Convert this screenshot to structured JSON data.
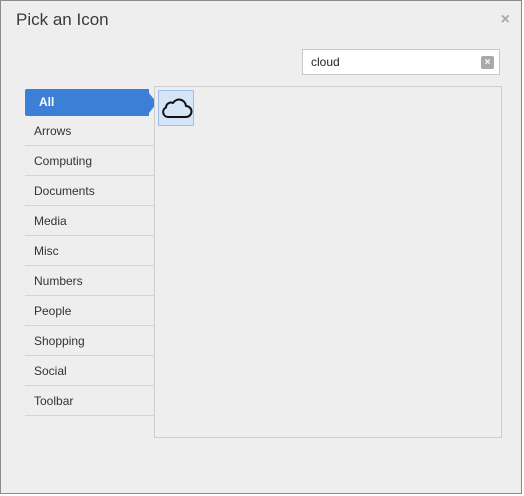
{
  "dialog": {
    "title": "Pick an Icon",
    "close_glyph": "×"
  },
  "search": {
    "value": "cloud",
    "clear_glyph": "×"
  },
  "categories": [
    {
      "label": "All",
      "active": true
    },
    {
      "label": "Arrows"
    },
    {
      "label": "Computing"
    },
    {
      "label": "Documents"
    },
    {
      "label": "Media"
    },
    {
      "label": "Misc"
    },
    {
      "label": "Numbers"
    },
    {
      "label": "People"
    },
    {
      "label": "Shopping"
    },
    {
      "label": "Social"
    },
    {
      "label": "Toolbar"
    }
  ],
  "results": [
    {
      "icon": "cloud-icon",
      "selected": true
    }
  ],
  "colors": {
    "accent": "#3c7fd6",
    "selected_tile": "#d5e5f7"
  }
}
